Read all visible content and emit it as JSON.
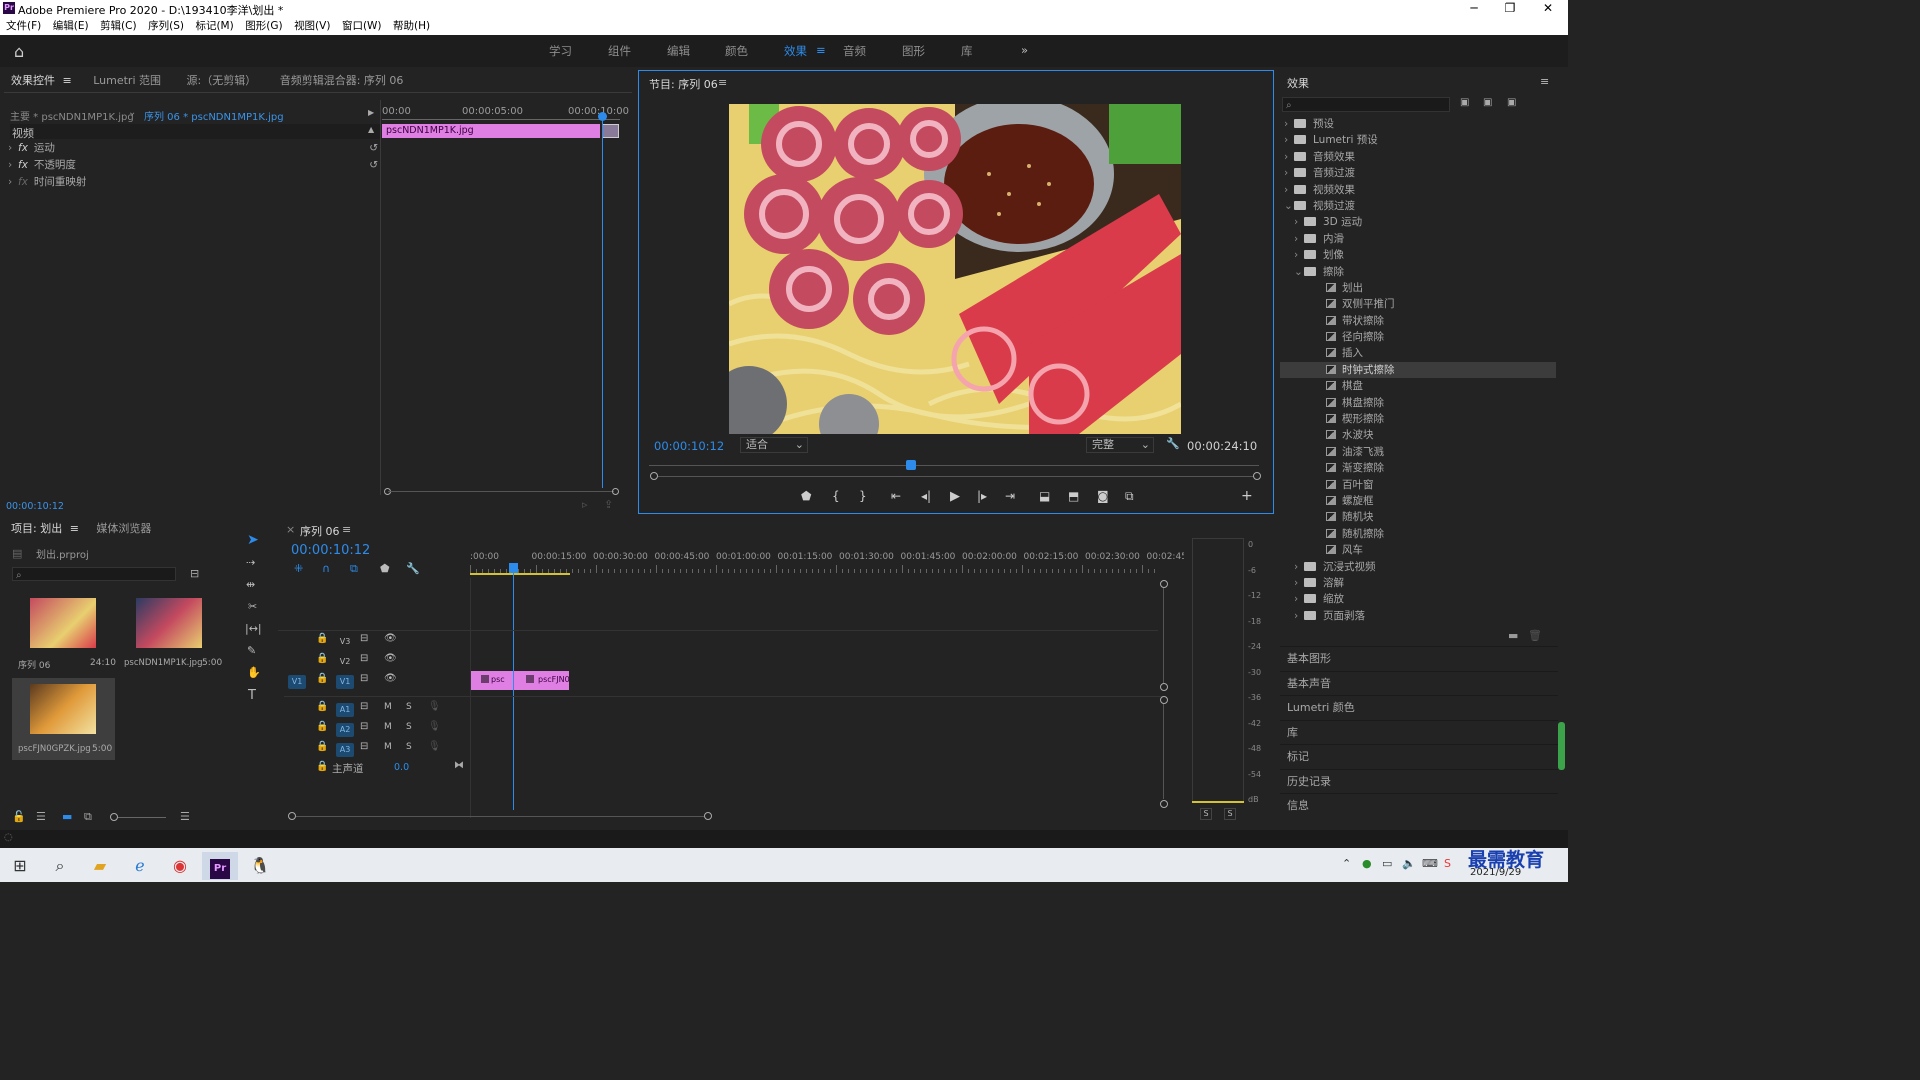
{
  "window": {
    "title": "Adobe Premiere Pro 2020 - D:\\193410李洋\\划出 *",
    "min": "─",
    "max": "❐",
    "close": "✕"
  },
  "menu": [
    "文件(F)",
    "编辑(E)",
    "剪辑(C)",
    "序列(S)",
    "标记(M)",
    "图形(G)",
    "视图(V)",
    "窗口(W)",
    "帮助(H)"
  ],
  "workspaces": [
    "学习",
    "组件",
    "编辑",
    "颜色",
    "效果",
    "音频",
    "图形",
    "库"
  ],
  "workspace_active": "效果",
  "workspace_more": "»",
  "effect_controls": {
    "tabs": [
      "效果控件",
      "Lumetri 范围",
      "源:（无剪辑）",
      "音频剪辑混合器: 序列 06"
    ],
    "master": "主要 * pscNDN1MP1K.jpg",
    "sequence": "序列 06 * pscNDN1MP1K.jpg",
    "section": "视频",
    "rows": [
      "运动",
      "不透明度",
      "时间重映射"
    ],
    "fx": "fx",
    "ruler": [
      "00:00",
      "00:00:05:00",
      "00:00:10:00"
    ],
    "clip": "pscNDN1MP1K.jpg",
    "timecode": "00:00:10:12"
  },
  "program": {
    "title": "节目: 序列 06",
    "timecode": "00:00:10:12",
    "fit": "适合",
    "quality": "完整",
    "duration": "00:00:24:10",
    "playhead_fraction": 0.43
  },
  "project": {
    "tabs": [
      "项目: 划出",
      "媒体浏览器"
    ],
    "file": "划出.prproj",
    "items": [
      {
        "name": "序列 06",
        "dur": "24:10"
      },
      {
        "name": "pscNDN1MP1K.jpg",
        "dur": "5:00"
      },
      {
        "name": "pscFJN0GPZK.jpg",
        "dur": "5:00"
      }
    ]
  },
  "timeline": {
    "tab": "序列 06",
    "timecode": "00:00:10:12",
    "ruler": [
      ":00:00",
      "00:00:15:00",
      "00:00:30:00",
      "00:00:45:00",
      "00:01:00:00",
      "00:01:15:00",
      "00:01:30:00",
      "00:01:45:00",
      "00:02:00:00",
      "00:02:15:00",
      "00:02:30:00",
      "00:02:45:"
    ],
    "video_tracks": [
      "V3",
      "V2",
      "V1"
    ],
    "audio_tracks": [
      "A1",
      "A2",
      "A3"
    ],
    "source_v": "V1",
    "master": "主声道",
    "master_val": "0.0",
    "m": "M",
    "s": "S",
    "clips": [
      "psc",
      "pscFJN0"
    ]
  },
  "meter": {
    "scale": [
      "0",
      "-6",
      "-12",
      "-18",
      "-24",
      "-30",
      "-36",
      "-42",
      "-48",
      "-54",
      "dB"
    ],
    "solo": [
      "S",
      "S"
    ]
  },
  "effects": {
    "title": "效果",
    "tree": [
      {
        "label": "预设",
        "level": 0,
        "type": "folder",
        "open": false
      },
      {
        "label": "Lumetri 预设",
        "level": 0,
        "type": "folder",
        "open": false
      },
      {
        "label": "音频效果",
        "level": 0,
        "type": "folder",
        "open": false
      },
      {
        "label": "音频过渡",
        "level": 0,
        "type": "folder",
        "open": false
      },
      {
        "label": "视频效果",
        "level": 0,
        "type": "folder",
        "open": false
      },
      {
        "label": "视频过渡",
        "level": 0,
        "type": "folder",
        "open": true
      },
      {
        "label": "3D 运动",
        "level": 1,
        "type": "folder",
        "open": false
      },
      {
        "label": "内滑",
        "level": 1,
        "type": "folder",
        "open": false
      },
      {
        "label": "划像",
        "level": 1,
        "type": "folder",
        "open": false
      },
      {
        "label": "擦除",
        "level": 1,
        "type": "folder",
        "open": true
      },
      {
        "label": "划出",
        "level": 2,
        "type": "item"
      },
      {
        "label": "双侧平推门",
        "level": 2,
        "type": "item"
      },
      {
        "label": "带状擦除",
        "level": 2,
        "type": "item"
      },
      {
        "label": "径向擦除",
        "level": 2,
        "type": "item"
      },
      {
        "label": "插入",
        "level": 2,
        "type": "item"
      },
      {
        "label": "时钟式擦除",
        "level": 2,
        "type": "item",
        "selected": true
      },
      {
        "label": "棋盘",
        "level": 2,
        "type": "item"
      },
      {
        "label": "棋盘擦除",
        "level": 2,
        "type": "item"
      },
      {
        "label": "楔形擦除",
        "level": 2,
        "type": "item"
      },
      {
        "label": "水波块",
        "level": 2,
        "type": "item"
      },
      {
        "label": "油漆飞溅",
        "level": 2,
        "type": "item"
      },
      {
        "label": "渐变擦除",
        "level": 2,
        "type": "item"
      },
      {
        "label": "百叶窗",
        "level": 2,
        "type": "item"
      },
      {
        "label": "螺旋框",
        "level": 2,
        "type": "item"
      },
      {
        "label": "随机块",
        "level": 2,
        "type": "item"
      },
      {
        "label": "随机擦除",
        "level": 2,
        "type": "item"
      },
      {
        "label": "风车",
        "level": 2,
        "type": "item"
      },
      {
        "label": "沉浸式视频",
        "level": 1,
        "type": "folder",
        "open": false
      },
      {
        "label": "溶解",
        "level": 1,
        "type": "folder",
        "open": false
      },
      {
        "label": "缩放",
        "level": 1,
        "type": "folder",
        "open": false
      },
      {
        "label": "页面剥落",
        "level": 1,
        "type": "folder",
        "open": false
      }
    ],
    "collapsed_panels": [
      "基本图形",
      "基本声音",
      "Lumetri 颜色",
      "库",
      "标记",
      "历史记录",
      "信息"
    ]
  },
  "taskbar": {
    "date": "2021/9/29",
    "watermark": "最需教育"
  },
  "colors": {
    "accent": "#2d8ceb",
    "clip_pink": "#e07fe3",
    "bg": "#232323"
  }
}
